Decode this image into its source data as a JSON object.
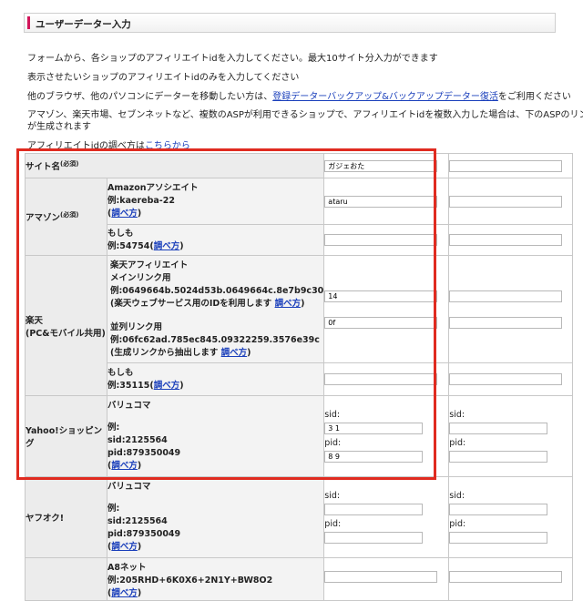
{
  "section_title": "ユーザーデーター入力",
  "intro": {
    "line1": "フォームから、各ショップのアフィリエイトidを入力してください。最大10サイト分入力ができます",
    "line2": "表示させたいショップのアフィリエイトidのみを入力してください",
    "line3_prefix": "他のブラウザ、他のパソコンにデーターを移動したい方は、",
    "line3_link": "登録データーバックアップ&バックアップデーター復活",
    "line3_suffix": "をご利用ください",
    "line4a": "アマゾン、楽天市場、セブンネットなど、複数のASPが利用できるショップで、アフィリエイトidを複数入力した場合は、下のASPのリンク",
    "line4b": "が生成されます",
    "line5_prefix": "アフィリエイトidの調べ方は",
    "line5_link": "こちらから"
  },
  "form": {
    "site_name": {
      "label": "サイト名",
      "required": "(必須)",
      "value": "ガジェおた"
    },
    "amazon": {
      "label": "アマゾン",
      "required": "(必須)",
      "associate": {
        "title": "Amazonアソシエイト",
        "example": "例:kaereba-22",
        "link": "調べ方",
        "value": "ataru"
      },
      "moshimo": {
        "title": "もしも",
        "example": "例:54754",
        "link": "調べ方",
        "value": ""
      }
    },
    "rakuten": {
      "label1": "楽天",
      "label2": "(PC&モバイル共用)",
      "affiliate": {
        "title": "楽天アフィリエイト",
        "subtitle": "メインリンク用",
        "example": "例:0649664b.5024d53b.0649664c.8e7b9c30",
        "note": "(楽天ウェブサービス用のIDを利用します",
        "link": "調べ方",
        "value": "14",
        "sub_title": "並列リンク用",
        "sub_example": "例:06fc62ad.785ec845.09322259.3576e39c",
        "sub_note": "(生成リンクから抽出します",
        "sub_link": "調べ方",
        "sub_value": "0f"
      },
      "moshimo": {
        "title": "もしも",
        "example": "例:35115",
        "link": "調べ方",
        "value": ""
      }
    },
    "yahoo_shopping": {
      "label1": "Yahoo!ショッピン",
      "label2": "グ",
      "title": "バリュコマ",
      "example": "例:",
      "sid_example": "sid:2125564",
      "pid_example": "pid:879350049",
      "link": "調べ方",
      "sid_label": "sid:",
      "pid_label": "pid:",
      "sid_value": "3 1",
      "pid_value": "8 9"
    },
    "yafuoku": {
      "label": "ヤフオク!",
      "title": "バリュコマ",
      "example": "例:",
      "sid_example": "sid:2125564",
      "pid_example": "pid:879350049",
      "link": "調べ方",
      "sid_label": "sid:",
      "pid_label": "pid:"
    },
    "a8": {
      "title": "A8ネット",
      "example": "例:205RHD+6K0X6+2N1Y+BW8O2",
      "link": "調べ方"
    }
  }
}
